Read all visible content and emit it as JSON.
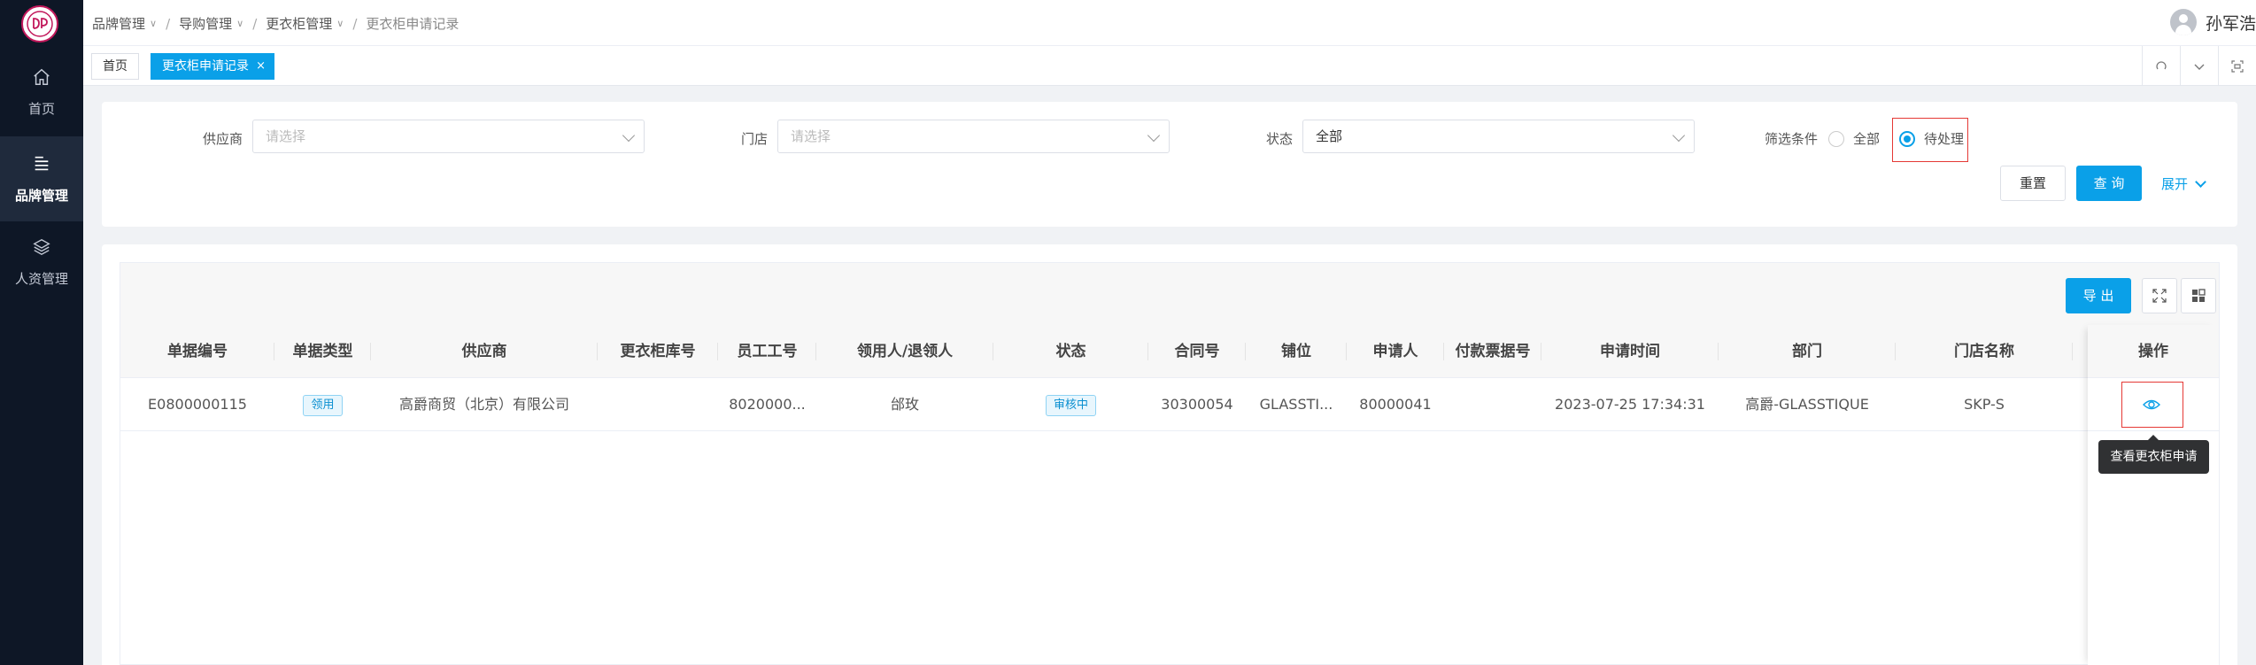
{
  "sidebar": {
    "items": [
      {
        "label": "首页",
        "icon": "home-icon"
      },
      {
        "label": "品牌管理",
        "icon": "menu-lines-icon"
      },
      {
        "label": "人资管理",
        "icon": "layers-icon"
      }
    ]
  },
  "header": {
    "breadcrumb": [
      "品牌管理",
      "导购管理",
      "更衣柜管理",
      "更衣柜申请记录"
    ],
    "user_name": "孙军浩"
  },
  "tabs": {
    "home": "首页",
    "active": "更衣柜申请记录",
    "close": "×"
  },
  "filters": {
    "supplier_label": "供应商",
    "supplier_placeholder": "请选择",
    "store_label": "门店",
    "store_placeholder": "请选择",
    "status_label": "状态",
    "status_value": "全部",
    "condition_label": "筛选条件",
    "condition_all": "全部",
    "condition_pending": "待处理",
    "reset": "重置",
    "query": "查 询",
    "expand": "展开"
  },
  "table": {
    "export": "导 出",
    "columns": [
      "单据编号",
      "单据类型",
      "供应商",
      "更衣柜库号",
      "员工工号",
      "领用人/退领人",
      "状态",
      "合同号",
      "铺位",
      "申请人",
      "付款票据号",
      "申请时间",
      "部门",
      "门店名称",
      "操作"
    ],
    "rows": [
      {
        "doc_no": "E0800000115",
        "doc_type": "领用",
        "supplier": "高爵商贸（北京）有限公司",
        "locker_no": "",
        "employee_no": "8020000...",
        "person": "邰玫",
        "status": "审核中",
        "contract_no": "30300054",
        "booth": "GLASSTI...",
        "applicant": "80000041",
        "invoice_no": "",
        "apply_time": "2023-07-25 17:34:31",
        "dept": "高爵-GLASSTIQUE",
        "store": "SKP-S"
      }
    ],
    "tooltip": "查看更衣柜申请"
  },
  "colors": {
    "primary": "#0aa0e8",
    "sidebar": "#0e1726",
    "highlight": "#e53935"
  }
}
